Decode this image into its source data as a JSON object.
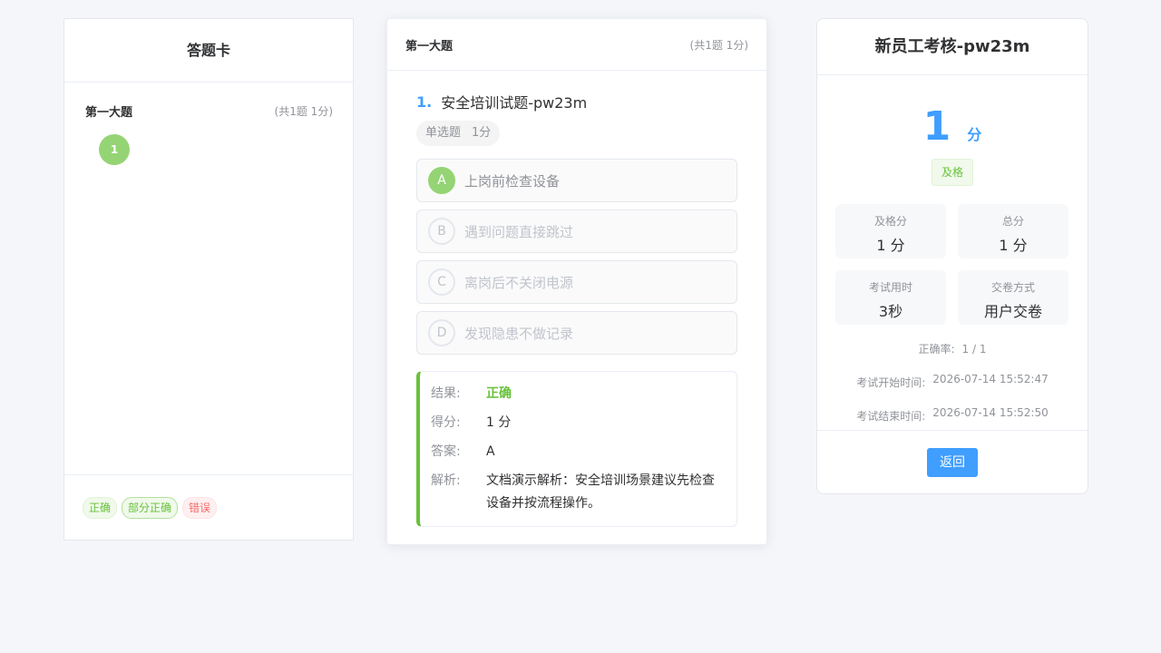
{
  "answer_card": {
    "title": "答题卡",
    "section_name": "第一大题",
    "section_meta": "(共1题 1分)",
    "numbers": [
      "1"
    ],
    "legend": {
      "correct": "正确",
      "partial": "部分正确",
      "wrong": "错误"
    }
  },
  "question": {
    "section_name": "第一大题",
    "section_meta": "(共1题 1分)",
    "index": "1.",
    "title": "安全培训试题-pw23m",
    "type": "单选题",
    "points": "1分",
    "options": [
      {
        "letter": "A",
        "text": "上岗前检查设备",
        "selected": true
      },
      {
        "letter": "B",
        "text": "遇到问题直接跳过",
        "selected": false
      },
      {
        "letter": "C",
        "text": "离岗后不关闭电源",
        "selected": false
      },
      {
        "letter": "D",
        "text": "发现隐患不做记录",
        "selected": false
      }
    ],
    "result": {
      "result_label": "结果:",
      "result_value": "正确",
      "score_label": "得分:",
      "score_value": "1 分",
      "answer_label": "答案:",
      "answer_value": "A",
      "analysis_label": "解析:",
      "analysis_value": "文档演示解析：安全培训场景建议先检查设备并按流程操作。"
    }
  },
  "score_panel": {
    "title": "新员工考核-pw23m",
    "score": "1",
    "unit": "分",
    "pass_tag": "及格",
    "stats": [
      {
        "label": "及格分",
        "value": "1 分"
      },
      {
        "label": "总分",
        "value": "1 分"
      },
      {
        "label": "考试用时",
        "value": "3秒"
      },
      {
        "label": "交卷方式",
        "value": "用户交卷"
      }
    ],
    "accuracy_label": "正确率:",
    "accuracy_value": "1 / 1",
    "start_label": "考试开始时间:",
    "start_value": "2026-07-14 15:52:47",
    "end_label": "考试结束时间:",
    "end_value": "2026-07-14 15:52:50",
    "back_label": "返回"
  },
  "colors": {
    "primary": "#409eff",
    "success": "#67c23a",
    "success_light": "#95d475",
    "danger": "#f56c6c"
  }
}
